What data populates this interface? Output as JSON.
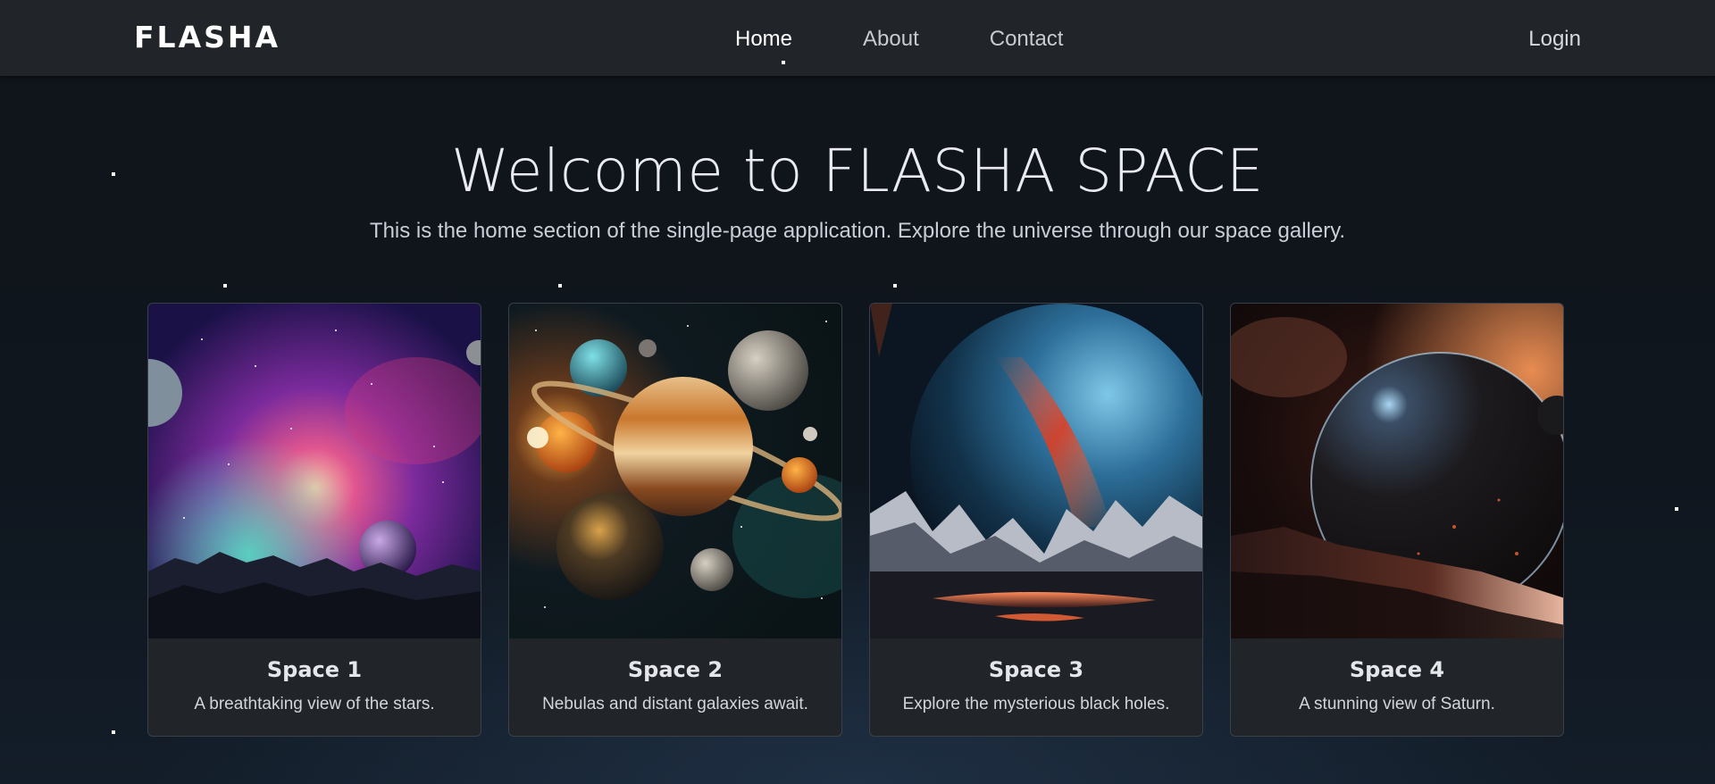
{
  "navbar": {
    "brand": "FLASHA",
    "links": [
      {
        "label": "Home",
        "active": true
      },
      {
        "label": "About",
        "active": false
      },
      {
        "label": "Contact",
        "active": false
      }
    ],
    "login": "Login"
  },
  "hero": {
    "title": "Welcome to FLASHA SPACE",
    "subtitle": "This is the home section of the single-page application. Explore the universe through our space gallery."
  },
  "cards": [
    {
      "title": "Space 1",
      "text": "A breathtaking view of the stars.",
      "image_icon": "nebula-image"
    },
    {
      "title": "Space 2",
      "text": "Nebulas and distant galaxies await.",
      "image_icon": "planets-image"
    },
    {
      "title": "Space 3",
      "text": "Explore the mysterious black holes.",
      "image_icon": "planet-mountains-image"
    },
    {
      "title": "Space 4",
      "text": "A stunning view of Saturn.",
      "image_icon": "planet-horizon-image"
    }
  ],
  "colors": {
    "navbar_bg": "#212529",
    "card_bg": "#212529",
    "page_bg": "#0f141b"
  }
}
